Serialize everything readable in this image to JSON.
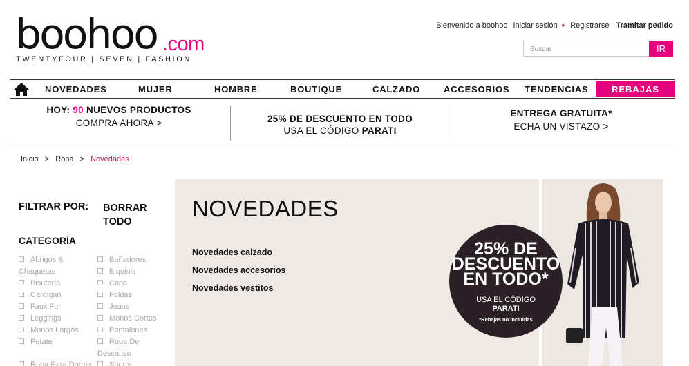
{
  "logo": {
    "main": "boohoo",
    "com": ".com",
    "tagline": "TWENTYFOUR | SEVEN | FASHION"
  },
  "topbar": {
    "welcome": "Bienvenido a boohoo",
    "login": "Iniciar sesión",
    "dot": "•",
    "register": "Registrarse",
    "checkout": "Tramitar pedido"
  },
  "search": {
    "placeholder": "Buscar",
    "button": "IR"
  },
  "nav": {
    "home_icon": "home-icon",
    "items": [
      "NOVEDADES",
      "MUJER",
      "HOMBRE",
      "BOUTIQUE",
      "CALZADO",
      "ACCESORIOS",
      "TENDENCIAS"
    ],
    "sale": "REBAJAS"
  },
  "promos": {
    "p1": {
      "pre": "HOY: ",
      "num": "90",
      "post": " NUEVOS PRODUCTOS",
      "line2": "COMPRA AHORA >"
    },
    "p2": {
      "line1": "25% DE DESCUENTO EN TODO",
      "line2_pre": "USA EL CÓDIGO ",
      "code": "PARATI"
    },
    "p3": {
      "line1": "ENTREGA GRATUITA*",
      "line2": "ECHA UN VISTAZO >"
    }
  },
  "breadcrumb": {
    "home": "Inicio",
    "sep": ">",
    "ropa": "Ropa",
    "current": "Novedades"
  },
  "filters": {
    "title": "FILTRAR POR:",
    "clear": "BORRAR TODO",
    "category_title": "CATEGORÍA",
    "col1": [
      "Abrigos &",
      "Chaquetas",
      "Bisutería",
      "Cárdigan",
      "Faux Fur",
      "Leggings",
      "Monos Largos",
      "Petate",
      "Ropa Para Dormir"
    ],
    "col2": [
      "Bañadores",
      "Biquinis",
      "Capa",
      "Faldas",
      "Jeans",
      "Monos Cortos",
      "Pantalones",
      "Ropa De",
      "Descanso",
      "Shorts"
    ]
  },
  "panel": {
    "title": "NOVEDADES",
    "links": [
      "Novedades calzado",
      "Novedades accesorios",
      "Novedades vestitos"
    ]
  },
  "badge": {
    "l1": "25% DE",
    "l2": "DESCUENTO",
    "l3": "EN TODO*",
    "s1": "USA EL CÓDIGO",
    "s2": "PARATI",
    "note": "*Rebajas no incluidas"
  },
  "colors": {
    "brand_pink": "#e5007e",
    "badge_bg": "#2b2026",
    "panel_bg": "#efe9e6"
  }
}
